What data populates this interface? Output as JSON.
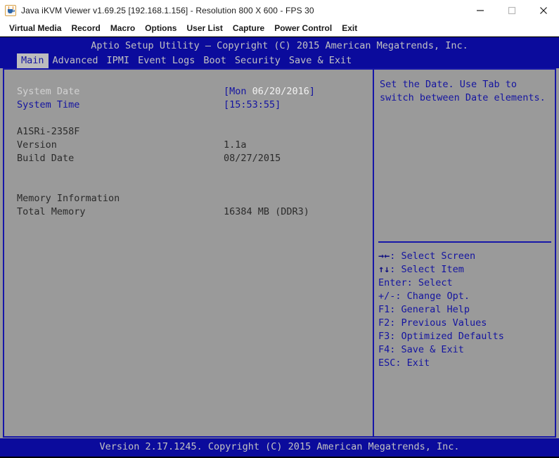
{
  "window": {
    "title": "Java iKVM Viewer v1.69.25 [192.168.1.156]  - Resolution 800 X 600 - FPS 30",
    "icon": "java-cup-icon",
    "controls": {
      "minimize": "minimize-icon",
      "maximize": "maximize-icon",
      "close": "close-icon"
    }
  },
  "menubar": {
    "items": [
      {
        "label": "Virtual Media"
      },
      {
        "label": "Record"
      },
      {
        "label": "Macro"
      },
      {
        "label": "Options"
      },
      {
        "label": "User List"
      },
      {
        "label": "Capture"
      },
      {
        "label": "Power Control"
      },
      {
        "label": "Exit"
      }
    ]
  },
  "bios": {
    "title": "Aptio Setup Utility – Copyright (C) 2015 American Megatrends, Inc.",
    "tabs": [
      {
        "label": "Main",
        "active": true
      },
      {
        "label": "Advanced",
        "active": false
      },
      {
        "label": "IPMI",
        "active": false
      },
      {
        "label": "Event Logs",
        "active": false
      },
      {
        "label": "Boot",
        "active": false
      },
      {
        "label": "Security",
        "active": false
      },
      {
        "label": "Save & Exit",
        "active": false
      }
    ],
    "main": {
      "system_date_label": "System Date",
      "system_date_bracket_open": "[Mon ",
      "system_date_value": "06/20/2016",
      "system_date_bracket_close": "]",
      "system_time_label": "System Time",
      "system_time_value": "[15:53:55]",
      "board_model": "A1SRi-2358F",
      "version_label": "Version",
      "version_value": "1.1a",
      "build_date_label": "Build Date",
      "build_date_value": "08/27/2015",
      "memory_information_label": "Memory Information",
      "total_memory_label": "Total Memory",
      "total_memory_value": "16384 MB (DDR3)"
    },
    "help": {
      "text": "Set the Date. Use Tab to switch between Date elements."
    },
    "legend": [
      {
        "key": "→←",
        "text": ": Select Screen"
      },
      {
        "key": "↑↓",
        "text": ": Select Item"
      },
      {
        "key": "Enter",
        "text": ": Select"
      },
      {
        "key": "+/-",
        "text": ": Change Opt."
      },
      {
        "key": "F1",
        "text": ": General Help"
      },
      {
        "key": "F2",
        "text": ": Previous Values"
      },
      {
        "key": "F3",
        "text": ": Optimized Defaults"
      },
      {
        "key": "F4",
        "text": ": Save & Exit"
      },
      {
        "key": "ESC",
        "text": ": Exit"
      }
    ],
    "footer": "Version 2.17.1245. Copyright (C) 2015 American Megatrends, Inc."
  },
  "colors": {
    "bios_blue": "#0b0b9c",
    "bios_border": "#1616a8",
    "bios_gray": "#9a9a9a",
    "text_blue": "#1414a0",
    "text_light": "#c2c2c2",
    "text_dark": "#2b2b2b"
  }
}
